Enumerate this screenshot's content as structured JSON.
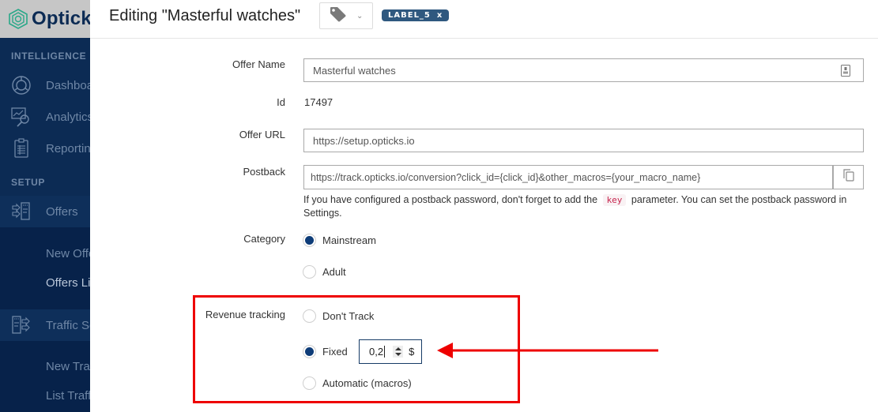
{
  "app": {
    "brand": "Opticks"
  },
  "sidebar": {
    "sections": [
      {
        "label": "INTELLIGENCE"
      },
      {
        "label": "SETUP"
      }
    ],
    "items": [
      {
        "label": "Dashboard",
        "icon": "dashboard-icon"
      },
      {
        "label": "Analytics",
        "icon": "analytics-icon"
      },
      {
        "label": "Reporting",
        "icon": "reporting-icon"
      },
      {
        "label": "Offers",
        "icon": "offers-icon"
      },
      {
        "label": "Traffic Sources",
        "icon": "traffic-sources-icon"
      }
    ],
    "offers_sub": [
      {
        "label": "New Offer"
      },
      {
        "label": "Offers List"
      }
    ],
    "traffic_sub": [
      {
        "label": "New Traffic Source"
      },
      {
        "label": "List Traffic Sources"
      }
    ]
  },
  "header": {
    "title": "Editing \"Masterful watches\"",
    "tag_select_icon": "tag-icon",
    "label_badge": {
      "text": "LABEL_5",
      "remove": "x"
    }
  },
  "form": {
    "offer_name": {
      "label": "Offer Name",
      "value": "Masterful watches"
    },
    "id": {
      "label": "Id",
      "value": "17497"
    },
    "offer_url": {
      "label": "Offer URL",
      "value": "https://setup.opticks.io"
    },
    "postback": {
      "label": "Postback",
      "value": "https://track.opticks.io/conversion?click_id={click_id}&other_macros={your_macro_name}",
      "help_before": "If you have configured a postback password, don't forget to add the",
      "help_code": "key",
      "help_after": "parameter. You can set the postback password in Settings."
    },
    "category": {
      "label": "Category",
      "options": [
        {
          "label": "Mainstream",
          "checked": true
        },
        {
          "label": "Adult",
          "checked": false
        }
      ]
    },
    "revenue_tracking": {
      "label": "Revenue tracking",
      "options": [
        {
          "label": "Don't Track",
          "checked": false
        },
        {
          "label": "Fixed",
          "checked": true
        },
        {
          "label": "Automatic (macros)",
          "checked": false
        }
      ],
      "fixed_value": "0,2",
      "currency": "$"
    }
  },
  "annotation": {
    "color": "#ee0000"
  }
}
